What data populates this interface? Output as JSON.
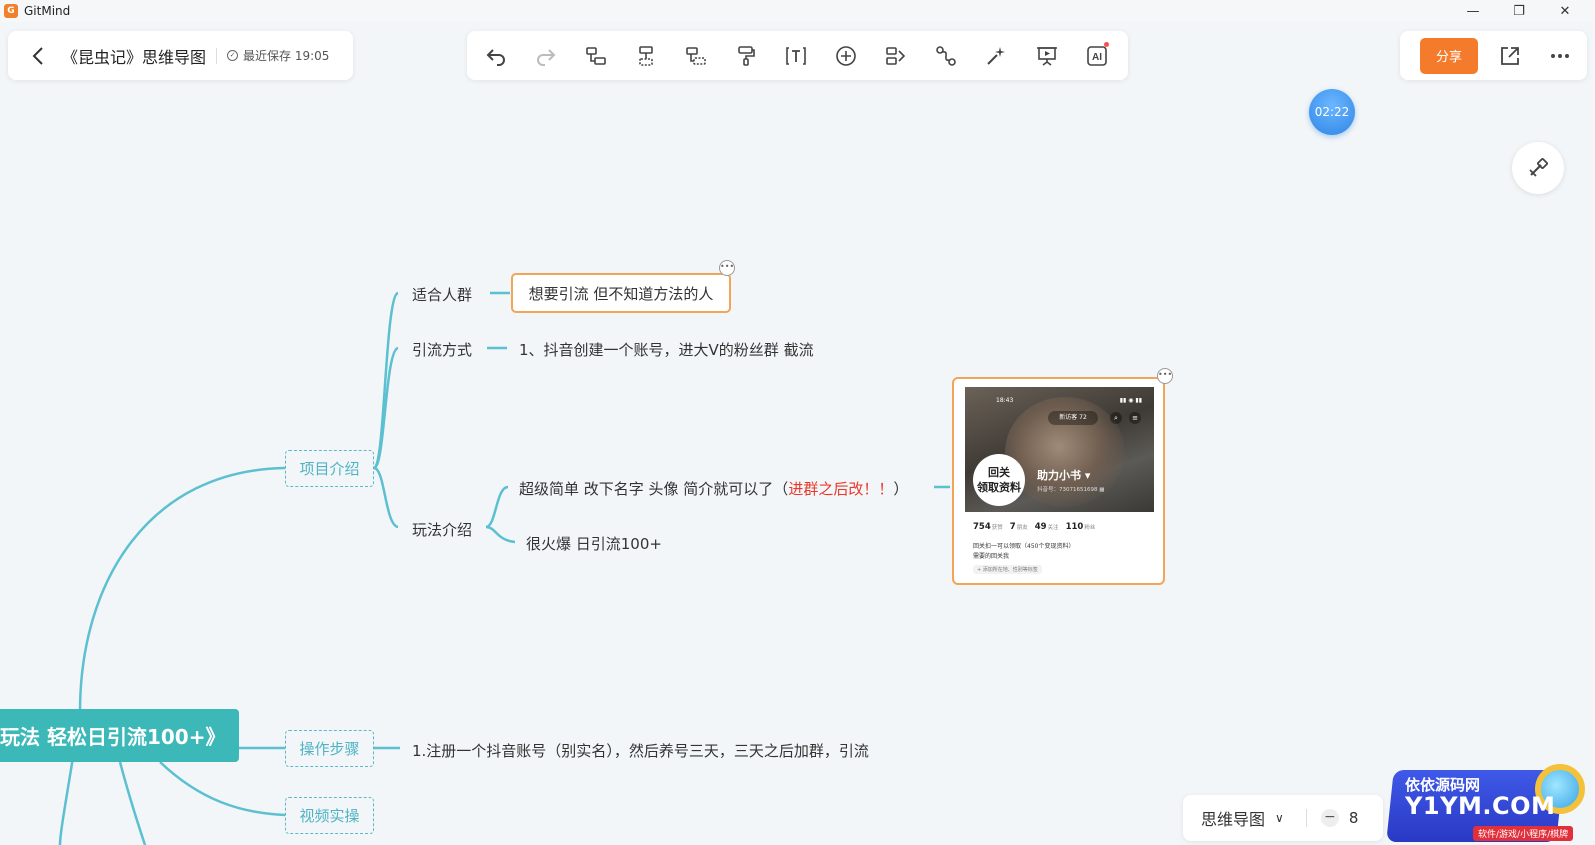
{
  "app": {
    "name": "GitMind",
    "logo_letter": "G"
  },
  "window": {
    "minimize": "—",
    "maximize": "❐",
    "close": "✕"
  },
  "header": {
    "doc_title": "《昆虫记》思维导图",
    "save_status": "最近保存 19:05"
  },
  "toolbar": {
    "tools": [
      "undo-icon",
      "redo-icon",
      "child-node-icon",
      "sibling-node-icon",
      "parent-node-icon",
      "format-painter-icon",
      "text-icon",
      "insert-icon",
      "outline-icon",
      "relation-icon",
      "style-icon",
      "present-icon",
      "ai-icon"
    ],
    "ai_label": "AI"
  },
  "right": {
    "share_label": "分享"
  },
  "timer": "02:22",
  "mindmap": {
    "root": "玩法 轻松日引流100+》",
    "branches": {
      "project_intro": "项目介绍",
      "steps": "操作步骤",
      "video": "视频实操"
    },
    "project_children": {
      "audience": "适合人群",
      "audience_value": "想要引流 但不知道方法的人",
      "method": "引流方式",
      "method_value": "1、抖音创建一个账号，进大V的粉丝群 截流",
      "play": "玩法介绍",
      "play_value_1_prefix": "超级简单 改下名字 头像 简介就可以了（",
      "play_value_1_red": "进群之后改！！",
      "play_value_1_suffix": "）",
      "play_value_2": "很火爆 日引流100+"
    },
    "steps_value": "1.注册一个抖音账号（别实名），然后养号三天，三天之后加群，引流"
  },
  "phone": {
    "time": "18:43",
    "status": "▮▮ ◉ ▮▮",
    "pill": "新访客 72",
    "avatar_line1": "回关",
    "avatar_line2": "领取资料",
    "name": "助力小书 ▾",
    "id": "抖音号：73071651698 ▦",
    "stats": [
      {
        "num": "754",
        "label": "获赞"
      },
      {
        "num": "7",
        "label": "朋友"
      },
      {
        "num": "49",
        "label": "关注"
      },
      {
        "num": "110",
        "label": "粉丝"
      }
    ],
    "bio_line1": "回关扣一可以领取（450个变现资料）",
    "bio_line2": "需要的回关我",
    "tag": "+ 添加所在地、性别等标签"
  },
  "bottom": {
    "view_mode": "思维导图",
    "zoom": "8"
  },
  "watermark": {
    "line1": "依依源码网",
    "line2": "Y1YM.COM",
    "line3": "软件/游戏/小程序/棋牌"
  },
  "colors": {
    "accent_orange": "#f57b2c",
    "branch_teal": "#5bc0d0",
    "root_teal": "#3bb8b7",
    "selected_border": "#f2a457",
    "red_text": "#e8392b"
  }
}
